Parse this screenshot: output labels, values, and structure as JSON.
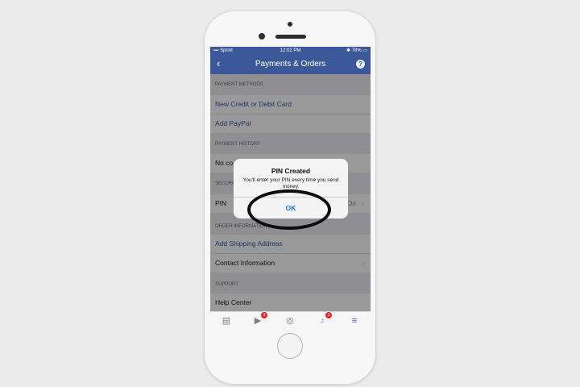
{
  "status_bar": {
    "carrier": "Sprint",
    "time": "12:02 PM",
    "battery": "78%"
  },
  "nav": {
    "back": "‹",
    "title": "Payments & Orders",
    "help": "?"
  },
  "sections": {
    "payment_methods": "PAYMENT METHODS",
    "payment_history": "PAYMENT HISTORY",
    "security": "SECURITY",
    "order_information": "ORDER INFORMATION",
    "support": "SUPPORT"
  },
  "rows": {
    "new_card": "New Credit or Debit Card",
    "add_paypal": "Add PayPal",
    "no_history": "No co",
    "pin": "PIN",
    "pin_value": "On",
    "add_shipping": "Add Shipping Address",
    "contact_info": "Contact Information",
    "help_center": "Help Center"
  },
  "dialog": {
    "title": "PIN Created",
    "message": "You'll enter your PIN every time you send money.",
    "ok": "OK"
  },
  "tabbar": {
    "items": [
      "news-feed",
      "video",
      "profile",
      "notifications",
      "menu"
    ],
    "badges": {
      "video": "3",
      "notifications": "1"
    }
  },
  "colors": {
    "brand": "#3b5998",
    "dialog_button": "#1a73e8",
    "badge": "#e02a2a"
  }
}
